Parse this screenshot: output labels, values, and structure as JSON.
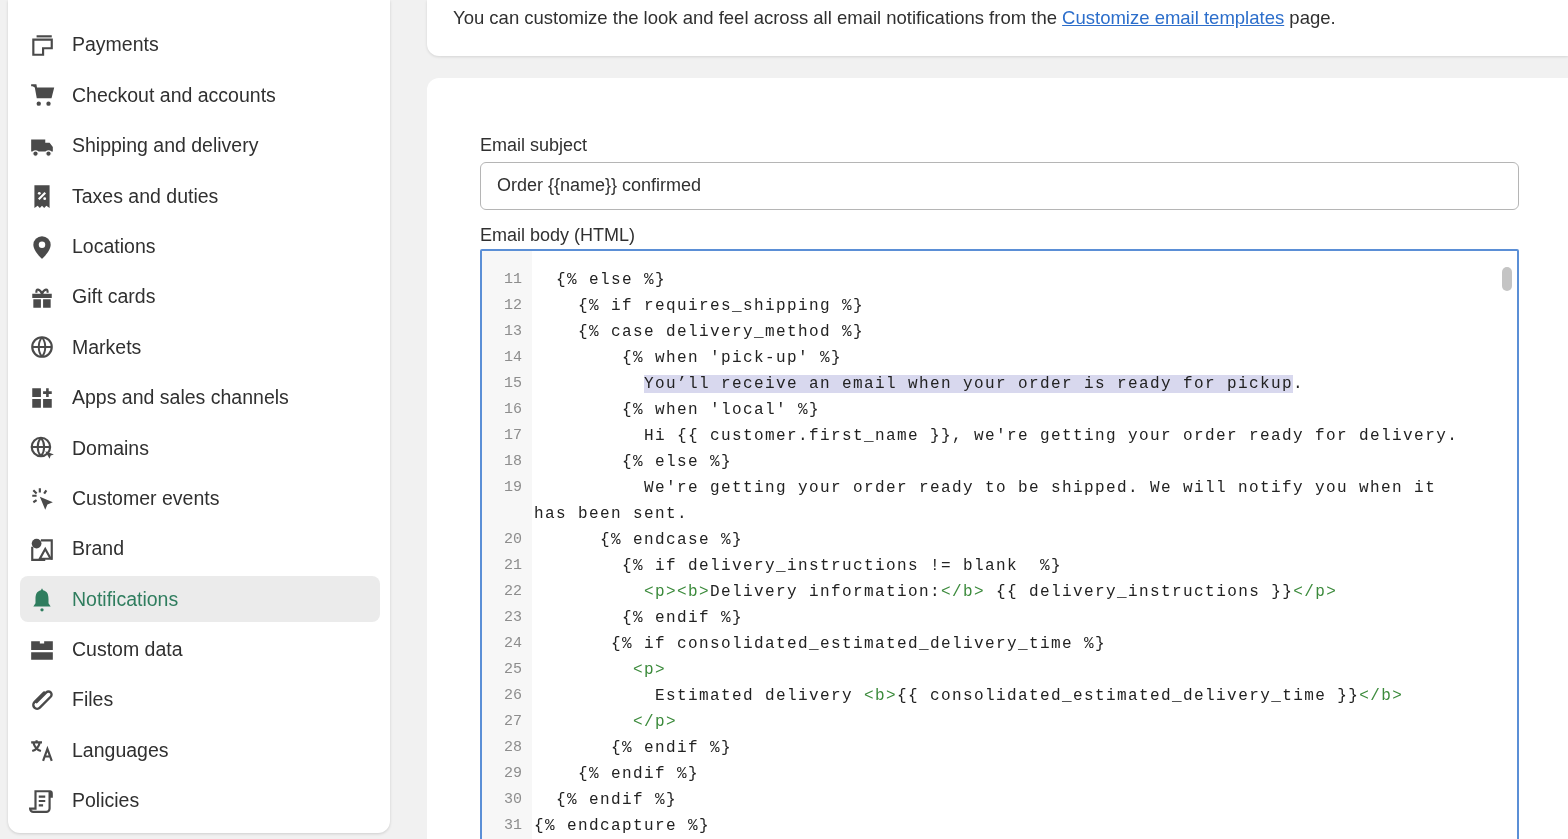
{
  "sidebar": {
    "items": [
      {
        "label": "Payments",
        "selected": false
      },
      {
        "label": "Checkout and accounts",
        "selected": false
      },
      {
        "label": "Shipping and delivery",
        "selected": false
      },
      {
        "label": "Taxes and duties",
        "selected": false
      },
      {
        "label": "Locations",
        "selected": false
      },
      {
        "label": "Gift cards",
        "selected": false
      },
      {
        "label": "Markets",
        "selected": false
      },
      {
        "label": "Apps and sales channels",
        "selected": false
      },
      {
        "label": "Domains",
        "selected": false
      },
      {
        "label": "Customer events",
        "selected": false
      },
      {
        "label": "Brand",
        "selected": false
      },
      {
        "label": "Notifications",
        "selected": true
      },
      {
        "label": "Custom data",
        "selected": false
      },
      {
        "label": "Files",
        "selected": false
      },
      {
        "label": "Languages",
        "selected": false
      },
      {
        "label": "Policies",
        "selected": false
      }
    ]
  },
  "intro": {
    "text": "You can customize the look and feel across all email notifications from the ",
    "link": "Customize email templates",
    "after": " page."
  },
  "subject": {
    "label": "Email subject",
    "value": "Order {{name}} confirmed"
  },
  "body": {
    "label": "Email body (HTML)",
    "lines": [
      {
        "number": "11",
        "tokens": [
          {
            "kind": "plain",
            "text": "  {% else %}"
          }
        ]
      },
      {
        "number": "12",
        "tokens": [
          {
            "kind": "plain",
            "text": "    {% if requires_shipping %}"
          }
        ]
      },
      {
        "number": "13",
        "tokens": [
          {
            "kind": "plain",
            "text": "    {% case delivery_method %}"
          }
        ]
      },
      {
        "number": "14",
        "tokens": [
          {
            "kind": "plain",
            "text": "        {% when 'pick-up' %}"
          }
        ]
      },
      {
        "number": "15",
        "tokens": [
          {
            "kind": "selection",
            "text": "          You’ll receive an email when your order is ready for pickup"
          },
          {
            "kind": "plain",
            "text": "."
          }
        ]
      },
      {
        "number": "16",
        "tokens": [
          {
            "kind": "plain",
            "text": "        {% when 'local' %}"
          }
        ]
      },
      {
        "number": "17",
        "tokens": [
          {
            "kind": "plain",
            "text": "          Hi {{ customer.first_name }}, we're getting your order ready for delivery."
          }
        ]
      },
      {
        "number": "18",
        "tokens": [
          {
            "kind": "plain",
            "text": "        {% else %}"
          }
        ]
      },
      {
        "number": "19",
        "tokens": [
          {
            "kind": "plain",
            "text": "          We're getting your order ready to be shipped. We will notify you when it has been sent."
          }
        ]
      },
      {
        "number": "20",
        "tokens": [
          {
            "kind": "plain",
            "text": "      {% endcase %}"
          }
        ]
      },
      {
        "number": "21",
        "tokens": [
          {
            "kind": "plain",
            "text": "        {% if delivery_instructions != blank  %}"
          }
        ]
      },
      {
        "number": "22",
        "tokens": [
          {
            "kind": "tag",
            "text": "          <p><b>"
          },
          {
            "kind": "plain",
            "text": "Delivery information:"
          },
          {
            "kind": "tag",
            "text": "</b>"
          },
          {
            "kind": "plain",
            "text": " {{ delivery_instructions }}"
          },
          {
            "kind": "tag",
            "text": "</p>"
          }
        ]
      },
      {
        "number": "23",
        "tokens": [
          {
            "kind": "plain",
            "text": "        {% endif %}"
          }
        ]
      },
      {
        "number": "24",
        "tokens": [
          {
            "kind": "plain",
            "text": "       {% if consolidated_estimated_delivery_time %}"
          }
        ]
      },
      {
        "number": "25",
        "tokens": [
          {
            "kind": "tag",
            "text": "         <p>"
          }
        ]
      },
      {
        "number": "26",
        "tokens": [
          {
            "kind": "plain",
            "text": "           Estimated delivery "
          },
          {
            "kind": "tag",
            "text": "<b>"
          },
          {
            "kind": "plain",
            "text": "{{ consolidated_estimated_delivery_time }}"
          },
          {
            "kind": "tag",
            "text": "</b>"
          }
        ]
      },
      {
        "number": "27",
        "tokens": [
          {
            "kind": "tag",
            "text": "         </p>"
          }
        ]
      },
      {
        "number": "28",
        "tokens": [
          {
            "kind": "plain",
            "text": "       {% endif %}"
          }
        ]
      },
      {
        "number": "29",
        "tokens": [
          {
            "kind": "plain",
            "text": "    {% endif %}"
          }
        ]
      },
      {
        "number": "30",
        "tokens": [
          {
            "kind": "plain",
            "text": "  {% endif %}"
          }
        ]
      },
      {
        "number": "31",
        "tokens": [
          {
            "kind": "plain",
            "text": "{% endcapture %}"
          }
        ]
      }
    ]
  }
}
